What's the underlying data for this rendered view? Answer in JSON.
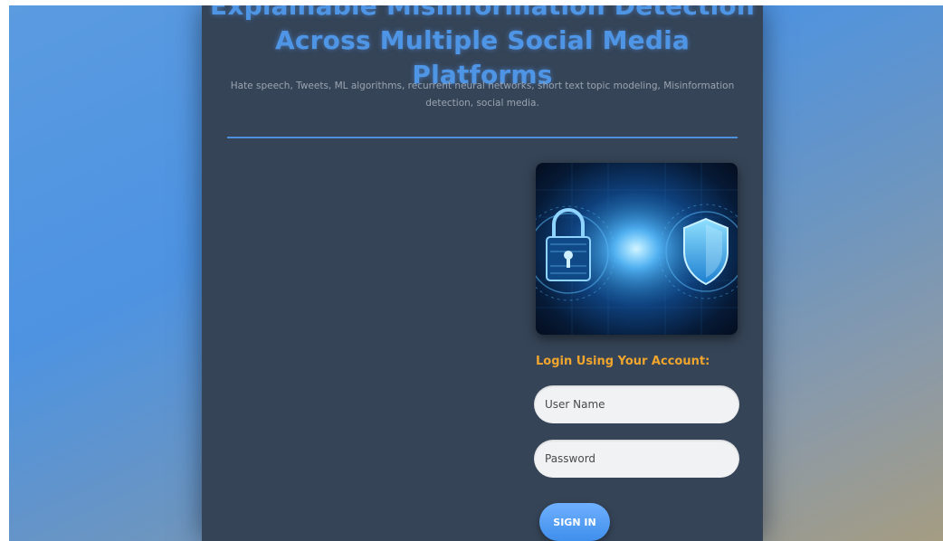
{
  "header": {
    "title": "Explainable Misinformation Detection Across Multiple Social Media Platforms",
    "keywords": "Hate speech, Tweets, ML algorithms, recurrent neural networks, short text topic modeling, Misinformation detection, social media."
  },
  "hero": {
    "image_icons": [
      "padlock-icon",
      "shield-icon"
    ]
  },
  "login": {
    "heading": "Login Using Your Account:",
    "username_placeholder": "User Name",
    "password_placeholder": "Password",
    "signin_label": "SIGN IN"
  },
  "colors": {
    "accent_blue": "#4f95e6",
    "heading_orange": "#f0a52d",
    "panel": "#354457"
  }
}
